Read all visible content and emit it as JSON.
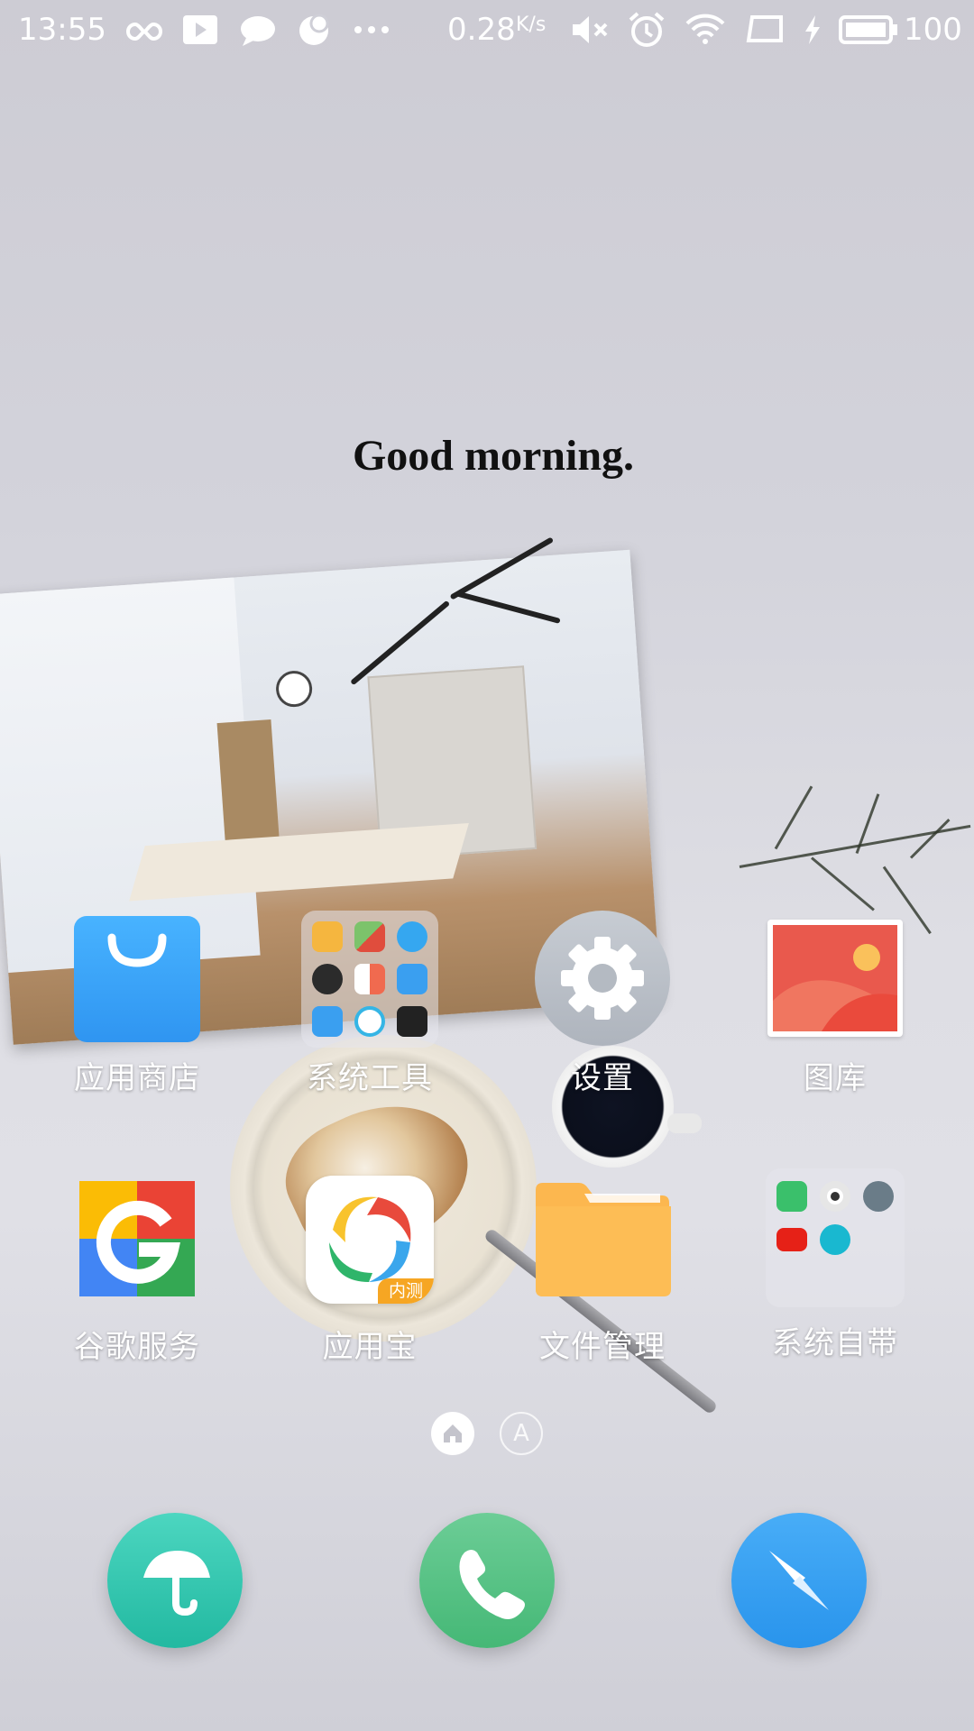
{
  "status_bar": {
    "time": "13:55",
    "net_speed": "0.28",
    "net_unit": "K/s",
    "battery": "100"
  },
  "greeting": "Good morning.",
  "apps": [
    {
      "label": "应用商店",
      "icon": "app-store-icon"
    },
    {
      "label": "系统工具",
      "icon": "system-tools-folder-icon"
    },
    {
      "label": "设置",
      "icon": "settings-gear-icon"
    },
    {
      "label": "图库",
      "icon": "gallery-icon"
    },
    {
      "label": "谷歌服务",
      "icon": "google-icon"
    },
    {
      "label": "应用宝",
      "icon": "yingyongbao-icon",
      "badge": "内测"
    },
    {
      "label": "文件管理",
      "icon": "file-manager-folder-icon"
    },
    {
      "label": "系统自带",
      "icon": "system-apps-folder-icon"
    }
  ],
  "page_indicator": {
    "home_icon": "home-icon",
    "a_label": "A"
  },
  "dock": [
    {
      "icon": "umbrella-icon",
      "color": "#36c8b0"
    },
    {
      "icon": "phone-icon",
      "color": "#5cc98a"
    },
    {
      "icon": "compass-icon",
      "color": "#3a9ff0"
    }
  ]
}
